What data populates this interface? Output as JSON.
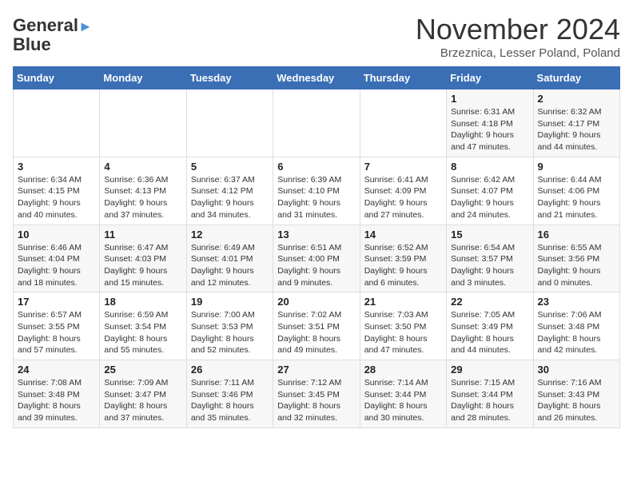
{
  "logo": {
    "line1": "General",
    "line2": "Blue"
  },
  "title": "November 2024",
  "subtitle": "Brzeznica, Lesser Poland, Poland",
  "weekdays": [
    "Sunday",
    "Monday",
    "Tuesday",
    "Wednesday",
    "Thursday",
    "Friday",
    "Saturday"
  ],
  "weeks": [
    [
      {
        "day": "",
        "info": ""
      },
      {
        "day": "",
        "info": ""
      },
      {
        "day": "",
        "info": ""
      },
      {
        "day": "",
        "info": ""
      },
      {
        "day": "",
        "info": ""
      },
      {
        "day": "1",
        "info": "Sunrise: 6:31 AM\nSunset: 4:18 PM\nDaylight: 9 hours and 47 minutes."
      },
      {
        "day": "2",
        "info": "Sunrise: 6:32 AM\nSunset: 4:17 PM\nDaylight: 9 hours and 44 minutes."
      }
    ],
    [
      {
        "day": "3",
        "info": "Sunrise: 6:34 AM\nSunset: 4:15 PM\nDaylight: 9 hours and 40 minutes."
      },
      {
        "day": "4",
        "info": "Sunrise: 6:36 AM\nSunset: 4:13 PM\nDaylight: 9 hours and 37 minutes."
      },
      {
        "day": "5",
        "info": "Sunrise: 6:37 AM\nSunset: 4:12 PM\nDaylight: 9 hours and 34 minutes."
      },
      {
        "day": "6",
        "info": "Sunrise: 6:39 AM\nSunset: 4:10 PM\nDaylight: 9 hours and 31 minutes."
      },
      {
        "day": "7",
        "info": "Sunrise: 6:41 AM\nSunset: 4:09 PM\nDaylight: 9 hours and 27 minutes."
      },
      {
        "day": "8",
        "info": "Sunrise: 6:42 AM\nSunset: 4:07 PM\nDaylight: 9 hours and 24 minutes."
      },
      {
        "day": "9",
        "info": "Sunrise: 6:44 AM\nSunset: 4:06 PM\nDaylight: 9 hours and 21 minutes."
      }
    ],
    [
      {
        "day": "10",
        "info": "Sunrise: 6:46 AM\nSunset: 4:04 PM\nDaylight: 9 hours and 18 minutes."
      },
      {
        "day": "11",
        "info": "Sunrise: 6:47 AM\nSunset: 4:03 PM\nDaylight: 9 hours and 15 minutes."
      },
      {
        "day": "12",
        "info": "Sunrise: 6:49 AM\nSunset: 4:01 PM\nDaylight: 9 hours and 12 minutes."
      },
      {
        "day": "13",
        "info": "Sunrise: 6:51 AM\nSunset: 4:00 PM\nDaylight: 9 hours and 9 minutes."
      },
      {
        "day": "14",
        "info": "Sunrise: 6:52 AM\nSunset: 3:59 PM\nDaylight: 9 hours and 6 minutes."
      },
      {
        "day": "15",
        "info": "Sunrise: 6:54 AM\nSunset: 3:57 PM\nDaylight: 9 hours and 3 minutes."
      },
      {
        "day": "16",
        "info": "Sunrise: 6:55 AM\nSunset: 3:56 PM\nDaylight: 9 hours and 0 minutes."
      }
    ],
    [
      {
        "day": "17",
        "info": "Sunrise: 6:57 AM\nSunset: 3:55 PM\nDaylight: 8 hours and 57 minutes."
      },
      {
        "day": "18",
        "info": "Sunrise: 6:59 AM\nSunset: 3:54 PM\nDaylight: 8 hours and 55 minutes."
      },
      {
        "day": "19",
        "info": "Sunrise: 7:00 AM\nSunset: 3:53 PM\nDaylight: 8 hours and 52 minutes."
      },
      {
        "day": "20",
        "info": "Sunrise: 7:02 AM\nSunset: 3:51 PM\nDaylight: 8 hours and 49 minutes."
      },
      {
        "day": "21",
        "info": "Sunrise: 7:03 AM\nSunset: 3:50 PM\nDaylight: 8 hours and 47 minutes."
      },
      {
        "day": "22",
        "info": "Sunrise: 7:05 AM\nSunset: 3:49 PM\nDaylight: 8 hours and 44 minutes."
      },
      {
        "day": "23",
        "info": "Sunrise: 7:06 AM\nSunset: 3:48 PM\nDaylight: 8 hours and 42 minutes."
      }
    ],
    [
      {
        "day": "24",
        "info": "Sunrise: 7:08 AM\nSunset: 3:48 PM\nDaylight: 8 hours and 39 minutes."
      },
      {
        "day": "25",
        "info": "Sunrise: 7:09 AM\nSunset: 3:47 PM\nDaylight: 8 hours and 37 minutes."
      },
      {
        "day": "26",
        "info": "Sunrise: 7:11 AM\nSunset: 3:46 PM\nDaylight: 8 hours and 35 minutes."
      },
      {
        "day": "27",
        "info": "Sunrise: 7:12 AM\nSunset: 3:45 PM\nDaylight: 8 hours and 32 minutes."
      },
      {
        "day": "28",
        "info": "Sunrise: 7:14 AM\nSunset: 3:44 PM\nDaylight: 8 hours and 30 minutes."
      },
      {
        "day": "29",
        "info": "Sunrise: 7:15 AM\nSunset: 3:44 PM\nDaylight: 8 hours and 28 minutes."
      },
      {
        "day": "30",
        "info": "Sunrise: 7:16 AM\nSunset: 3:43 PM\nDaylight: 8 hours and 26 minutes."
      }
    ]
  ]
}
